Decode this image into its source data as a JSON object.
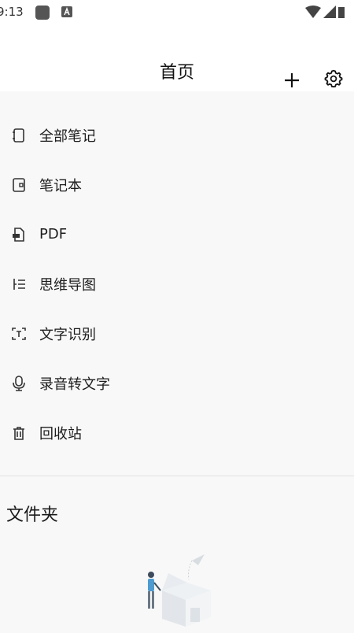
{
  "status_bar": {
    "time": "9:13"
  },
  "header": {
    "title": "首页",
    "add_icon": "plus-icon",
    "settings_icon": "gear-icon"
  },
  "menu": {
    "items": [
      {
        "label": "全部笔记",
        "icon": "notebook-icon"
      },
      {
        "label": "笔记本",
        "icon": "book-icon"
      },
      {
        "label": "PDF",
        "icon": "pdf-file-icon"
      },
      {
        "label": "思维导图",
        "icon": "mindmap-icon"
      },
      {
        "label": "文字识别",
        "icon": "text-scan-icon"
      },
      {
        "label": "录音转文字",
        "icon": "microphone-icon"
      },
      {
        "label": "回收站",
        "icon": "trash-icon"
      }
    ]
  },
  "folders": {
    "title": "文件夹"
  },
  "colors": {
    "background": "#f8f8f8",
    "header_bg": "#ffffff",
    "text": "#1d1d1d",
    "icon": "#333333"
  }
}
